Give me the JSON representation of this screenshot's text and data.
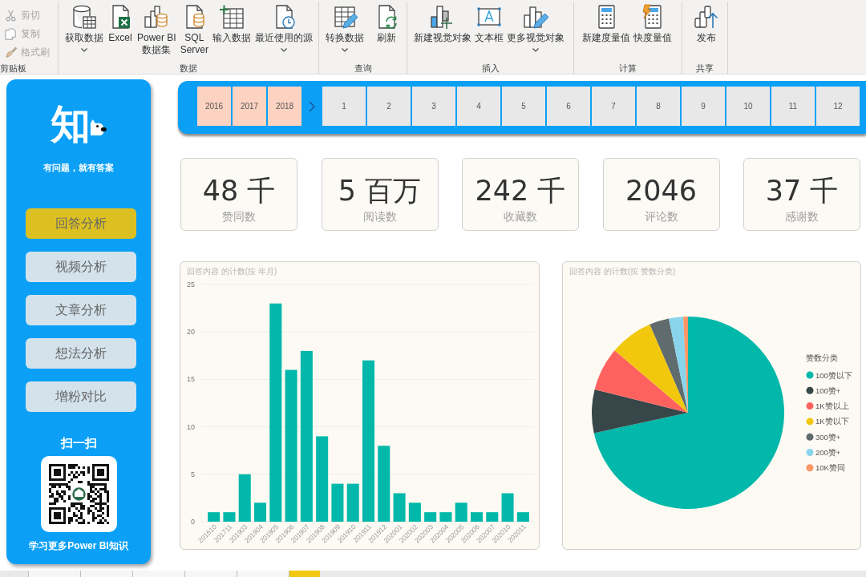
{
  "ribbon": {
    "clipboard": {
      "label": "剪贴板",
      "items": [
        {
          "label": "剪切",
          "disabled": true
        },
        {
          "label": "复制",
          "disabled": true
        },
        {
          "label": "格式刷",
          "disabled": true
        }
      ]
    },
    "groups": [
      {
        "label": "数据",
        "buttons": [
          {
            "label": "获取数据",
            "dropdown": true
          },
          {
            "label": "Excel",
            "dropdown": false
          },
          {
            "label": "Power BI\n数据集",
            "dropdown": false
          },
          {
            "label": "SQL\nServer",
            "dropdown": false
          },
          {
            "label": "输入数据",
            "dropdown": false
          },
          {
            "label": "最近使用的源",
            "dropdown": true
          }
        ]
      },
      {
        "label": "查询",
        "buttons": [
          {
            "label": "转换数据",
            "dropdown": true
          },
          {
            "label": "刷新",
            "dropdown": false
          }
        ]
      },
      {
        "label": "插入",
        "buttons": [
          {
            "label": "新建视觉对象",
            "dropdown": false
          },
          {
            "label": "文本框",
            "dropdown": false
          },
          {
            "label": "更多视觉对象",
            "dropdown": true
          }
        ]
      },
      {
        "label": "计算",
        "buttons": [
          {
            "label": "新建度量值",
            "dropdown": false
          },
          {
            "label": "快度量值",
            "dropdown": false
          }
        ]
      },
      {
        "label": "共享",
        "buttons": [
          {
            "label": "发布",
            "dropdown": false
          }
        ]
      }
    ]
  },
  "sidebar": {
    "logo_text": "知",
    "tagline": "有问题，就有答案",
    "nav": [
      {
        "label": "回答分析",
        "selected": true
      },
      {
        "label": "视频分析",
        "selected": false
      },
      {
        "label": "文章分析",
        "selected": false
      },
      {
        "label": "想法分析",
        "selected": false
      },
      {
        "label": "增粉对比",
        "selected": false
      }
    ],
    "scan_label": "扫一扫",
    "footer": "学习更多Power BI知识"
  },
  "slicer": {
    "years": [
      {
        "label": "2016",
        "selected": true
      },
      {
        "label": "2017",
        "selected": true
      },
      {
        "label": "2018",
        "selected": true
      }
    ],
    "months": [
      {
        "label": "1",
        "selected": false
      },
      {
        "label": "2",
        "selected": false
      },
      {
        "label": "3",
        "selected": false
      },
      {
        "label": "4",
        "selected": false
      },
      {
        "label": "5",
        "selected": false
      },
      {
        "label": "6",
        "selected": false
      },
      {
        "label": "7",
        "selected": false
      },
      {
        "label": "8",
        "selected": false
      },
      {
        "label": "9",
        "selected": false
      },
      {
        "label": "10",
        "selected": false
      },
      {
        "label": "11",
        "selected": false
      },
      {
        "label": "12",
        "selected": false
      }
    ]
  },
  "kpis": [
    {
      "value": "48 千",
      "label": "赞同数"
    },
    {
      "value": "5 百万",
      "label": "阅读数"
    },
    {
      "value": "242 千",
      "label": "收藏数"
    },
    {
      "value": "2046",
      "label": "评论数"
    },
    {
      "value": "37 千",
      "label": "感谢数"
    }
  ],
  "bar_chart": {
    "chart_data": {
      "type": "bar",
      "title": "回答内容 的计数(按 年月)",
      "categories": [
        "201610",
        "201711",
        "201903",
        "201904",
        "201905",
        "201906",
        "201907",
        "201908",
        "201909",
        "201910",
        "201911",
        "201912",
        "202001",
        "202002",
        "202003",
        "202004",
        "202005",
        "202006",
        "202007",
        "202010",
        "202011"
      ],
      "values": [
        1,
        1,
        5,
        2,
        23,
        16,
        18,
        9,
        4,
        4,
        17,
        8,
        3,
        2,
        1,
        1,
        2,
        1,
        1,
        3,
        1
      ],
      "ylim": [
        0,
        25
      ],
      "yticks": [
        0,
        5,
        10,
        15,
        20,
        25
      ],
      "grid": true
    }
  },
  "pie_chart": {
    "chart_data": {
      "type": "pie",
      "title": "回答内容 的计数(按 赞数分类)",
      "categories": [
        "100赞以下",
        "100赞+",
        "1K赞以上",
        "1K赞以下",
        "300赞+",
        "200赞+",
        "10K赞同"
      ],
      "values": [
        71.6,
        7.3,
        7.3,
        7.3,
        3.3,
        2.4,
        0.8
      ],
      "legend": {
        "title": "赞数分类",
        "items": [
          {
            "color": "#01b8aa"
          },
          {
            "color": "#374649"
          },
          {
            "color": "#fd625e"
          },
          {
            "color": "#f2c80f"
          },
          {
            "color": "#5f6b6d"
          },
          {
            "color": "#8ad4eb"
          },
          {
            "color": "#fe9666"
          }
        ]
      }
    }
  },
  "page_tabs": [
    {
      "selected": false
    },
    {
      "selected": false
    },
    {
      "selected": false
    },
    {
      "selected": false
    },
    {
      "selected": false
    },
    {
      "selected": true
    }
  ]
}
